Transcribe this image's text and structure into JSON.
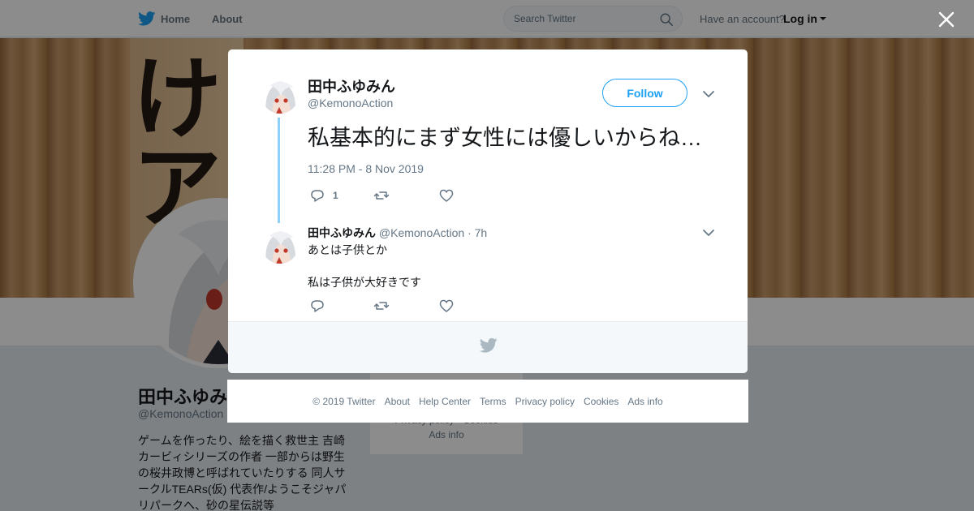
{
  "topbar": {
    "home_label": "Home",
    "about_label": "About",
    "search_placeholder": "Search Twitter",
    "account_prompt": "Have an account?",
    "login_label": "Log in"
  },
  "profile": {
    "name": "田中ふゆみん",
    "handle": "@KemonoAction",
    "bio_lines": [
      "ゲームを作ったり、絵を描く救世主 吉崎",
      "カービィシリーズの作者 一部からは野生",
      "の桜井政博と呼ばれていたりする 同人サ",
      "ークルTEARs(仮) 代表作/ようこそジャパ",
      "リパークへ、砂の星伝説等"
    ]
  },
  "side_card": {
    "line1": "Privacy policy · Cookies",
    "line2": "Ads info"
  },
  "tweet": {
    "author_name": "田中ふゆみん",
    "author_handle": "@KemonoAction",
    "follow_label": "Follow",
    "text": "私基本的にまず女性には優しいからね…",
    "timestamp": "11:28 PM - 8 Nov 2019",
    "reply_count": "1"
  },
  "reply": {
    "author_name": "田中ふゆみん",
    "author_handle": "@KemonoAction",
    "separator": "·",
    "time": "7h",
    "line1": "あとは子供とか",
    "line2": "私は子供が大好きです"
  },
  "footer_links": [
    "© 2019 Twitter",
    "About",
    "Help Center",
    "Terms",
    "Privacy policy",
    "Cookies",
    "Ads info"
  ],
  "colors": {
    "brand_blue": "#1da1f2",
    "thread_line": "#8ed0f9",
    "muted_text": "#657786"
  },
  "icons": [
    "twitter-bird-icon",
    "search-icon",
    "caret-down-icon",
    "close-icon",
    "reply-icon",
    "retweet-icon",
    "like-icon",
    "chevron-down-icon"
  ]
}
